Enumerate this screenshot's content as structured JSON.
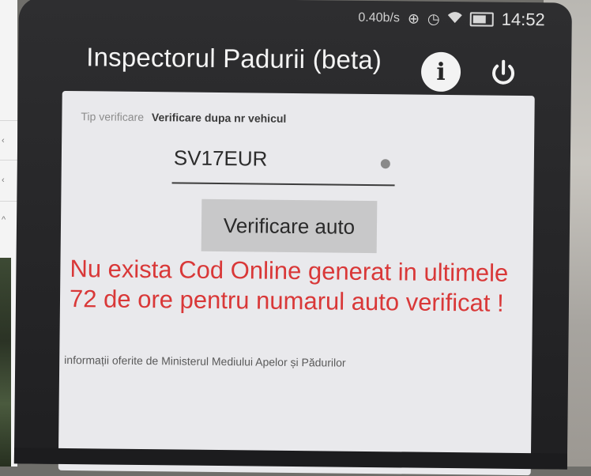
{
  "status_bar": {
    "net_speed": "0.40b/s",
    "time": "14:52",
    "icons": [
      "notification-icon",
      "clock-icon",
      "wifi-icon",
      "battery-icon"
    ]
  },
  "app": {
    "title": "Inspectorul Padurii (beta)",
    "info_icon": "i",
    "power_icon": "power-icon"
  },
  "form": {
    "type_label": "Tip verificare",
    "type_value": "Verificare dupa nr vehicul",
    "plate_value": "SV17EUR",
    "verify_button": "Verificare auto"
  },
  "result": {
    "error_message": "Nu exista Cod Online generat in ultimele 72 de ore pentru numarul auto verificat !",
    "info_note": "informații oferite de Ministerul Mediului Apelor și Pădurilor"
  },
  "colors": {
    "error": "#d93838",
    "card_bg": "#e9e9ec",
    "phone_bg": "#2e2e30",
    "button_bg": "#c8c8c9"
  }
}
